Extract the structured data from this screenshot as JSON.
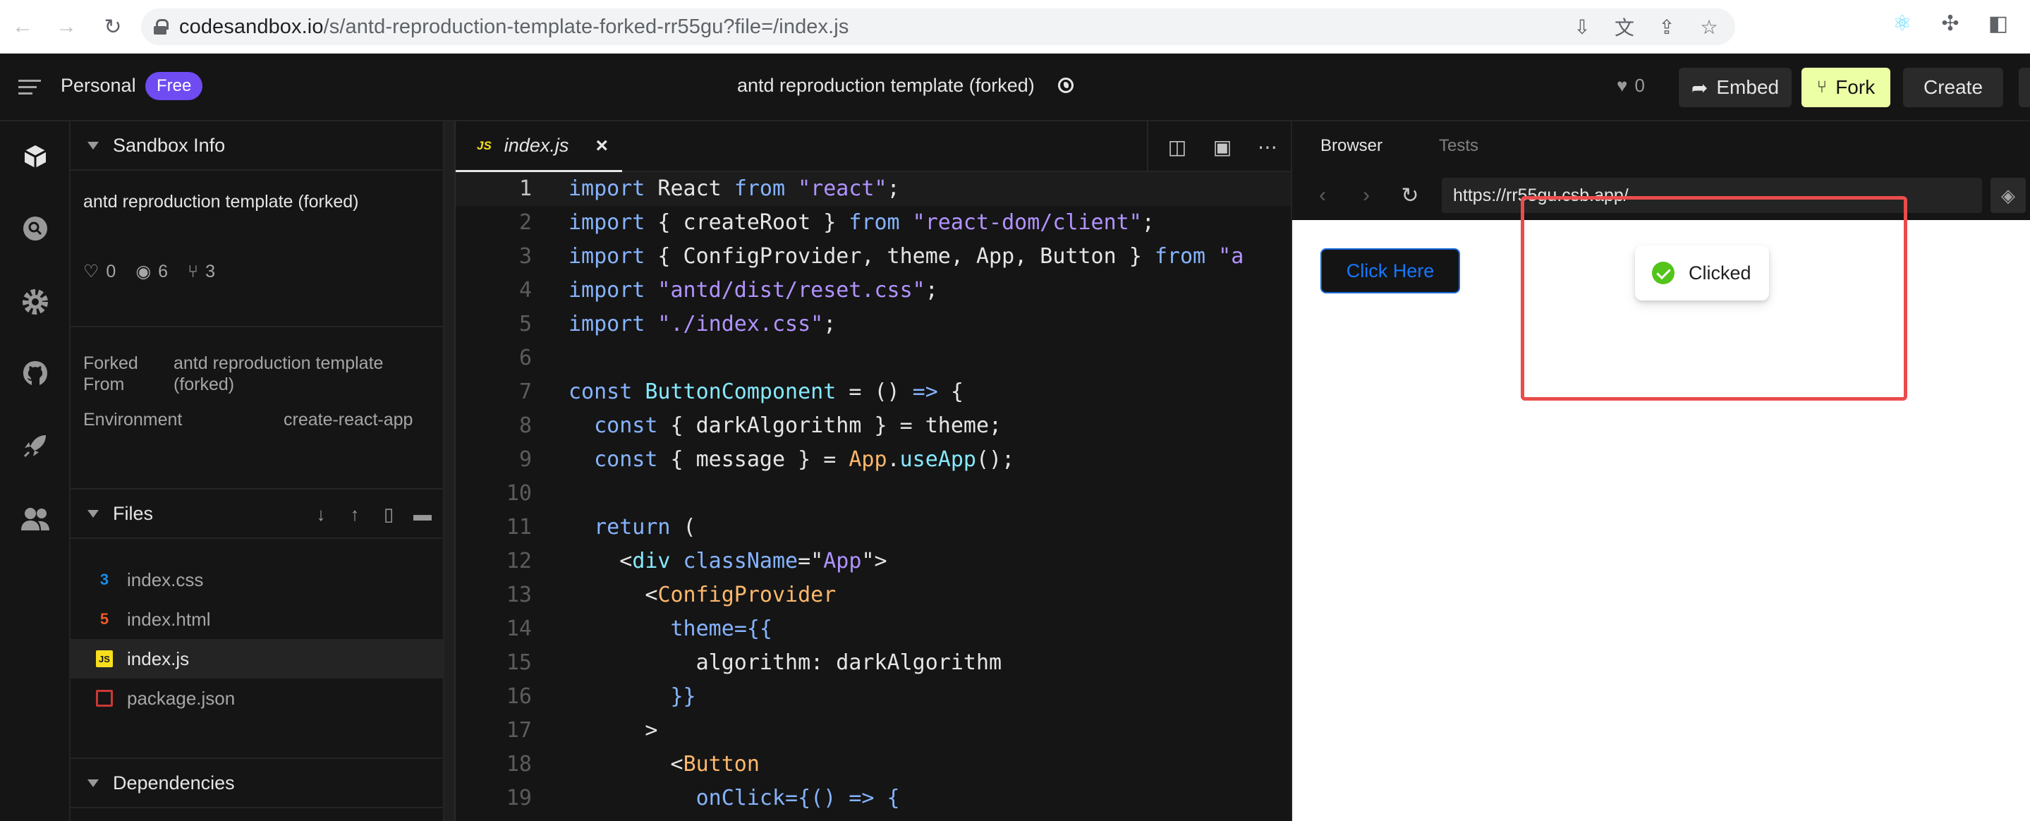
{
  "browser": {
    "url_host": "codesandbox.io",
    "url_path": "/s/antd-reproduction-template-forked-rr55gu?file=/index.js"
  },
  "header": {
    "workspace": "Personal",
    "plan_badge": "Free",
    "sandbox_title": "antd reproduction template (forked)",
    "likes": "0",
    "embed_label": "Embed",
    "fork_label": "Fork",
    "create_label": "Create"
  },
  "sidebar": {
    "info_title": "Sandbox Info",
    "description": "antd reproduction template (forked)",
    "stats": {
      "likes": "0",
      "views": "6",
      "forks": "3"
    },
    "forked_from_key_1": "Forked",
    "forked_from_key_2": "From",
    "forked_from_val_1": "antd reproduction template",
    "forked_from_val_2": "(forked)",
    "environment_key": "Environment",
    "environment_val": "create-react-app",
    "files_title": "Files",
    "files": [
      {
        "name": "index.css",
        "type": "css"
      },
      {
        "name": "index.html",
        "type": "html"
      },
      {
        "name": "index.js",
        "type": "js"
      },
      {
        "name": "package.json",
        "type": "json"
      }
    ],
    "dependencies_title": "Dependencies"
  },
  "editor": {
    "tab_name": "index.js",
    "tab_lang": "JS",
    "lines": [
      {
        "n": "1"
      },
      {
        "n": "2"
      },
      {
        "n": "3"
      },
      {
        "n": "4"
      },
      {
        "n": "5"
      },
      {
        "n": "6"
      },
      {
        "n": "7"
      },
      {
        "n": "8"
      },
      {
        "n": "9"
      },
      {
        "n": "10"
      },
      {
        "n": "11"
      },
      {
        "n": "12"
      },
      {
        "n": "13"
      },
      {
        "n": "14"
      },
      {
        "n": "15"
      },
      {
        "n": "16"
      },
      {
        "n": "17"
      },
      {
        "n": "18"
      },
      {
        "n": "19"
      }
    ],
    "code": {
      "l1": [
        "import",
        " React ",
        "from",
        " \"react\"",
        ";"
      ],
      "l2": [
        "import",
        " { createRoot } ",
        "from",
        " \"react-dom/client\"",
        ";"
      ],
      "l3": [
        "import",
        " { ConfigProvider, theme, App, Button } ",
        "from",
        " \"a"
      ],
      "l4": [
        "import",
        " \"antd/dist/reset.css\"",
        ";"
      ],
      "l5": [
        "import",
        " \"./index.css\"",
        ";"
      ],
      "l7": [
        "const",
        " ButtonComponent",
        " = () ",
        "=>",
        " {"
      ],
      "l8": [
        "  const",
        " { darkAlgorithm } = theme;"
      ],
      "l9": [
        "  const",
        " { message } = ",
        "App",
        ".",
        "useApp",
        "();"
      ],
      "l11": [
        "  return",
        " ("
      ],
      "l12": [
        "    <",
        "div",
        " className",
        "=\"",
        "App",
        "\">"
      ],
      "l13": [
        "      <",
        "ConfigProvider"
      ],
      "l14": [
        "        theme",
        "={{"
      ],
      "l15": [
        "          algorithm: darkAlgorithm"
      ],
      "l16": [
        "        }}"
      ],
      "l17": [
        "      >"
      ],
      "l18": [
        "        <",
        "Button"
      ],
      "l19": [
        "          onClick",
        "={() ",
        "=>",
        " {"
      ]
    }
  },
  "preview": {
    "tab_browser": "Browser",
    "tab_tests": "Tests",
    "url": "https://rr55gu.csb.app/",
    "button_label": "Click Here",
    "toast_text": "Clicked"
  },
  "colors": {
    "accent_badge": "#6f4bf2",
    "fork_button": "#edffa5",
    "antd_primary": "#1677ff",
    "success": "#52c41a",
    "annotation": "#ea4c4c"
  }
}
